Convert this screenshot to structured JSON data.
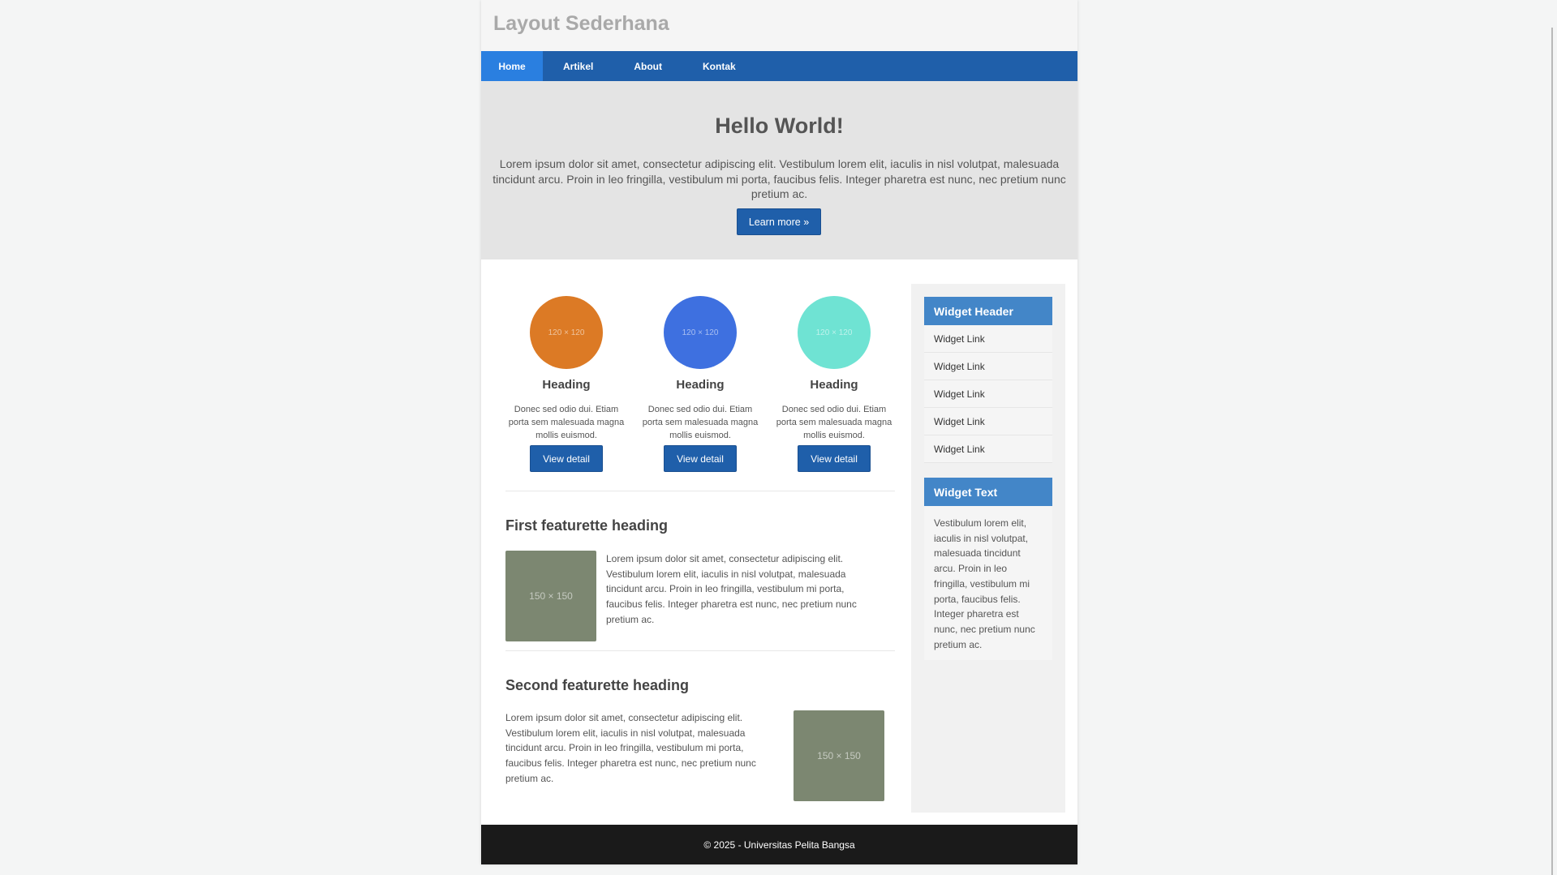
{
  "site": {
    "title": "Layout Sederhana"
  },
  "nav": {
    "items": [
      {
        "label": "Home"
      },
      {
        "label": "Artikel"
      },
      {
        "label": "About"
      },
      {
        "label": "Kontak"
      }
    ]
  },
  "hero": {
    "title": "Hello World!",
    "text": "Lorem ipsum dolor sit amet, consectetur adipiscing elit. Vestibulum lorem elit, iaculis in nisl volutpat, malesuada tincidunt arcu. Proin in leo fringilla, vestibulum mi porta, faucibus felis. Integer pharetra est nunc, nec pretium nunc pretium ac.",
    "button": "Learn more »"
  },
  "features": [
    {
      "placeholder": "120 × 120",
      "color": "#dc7a25",
      "heading": "Heading",
      "text": "Donec sed odio dui. Etiam porta sem malesuada magna mollis euismod.",
      "button": "View detail"
    },
    {
      "placeholder": "120 × 120",
      "color": "#3e70e0",
      "heading": "Heading",
      "text": "Donec sed odio dui. Etiam porta sem malesuada magna mollis euismod.",
      "button": "View detail"
    },
    {
      "placeholder": "120 × 120",
      "color": "#6fe3d3",
      "heading": "Heading",
      "text": "Donec sed odio dui. Etiam porta sem malesuada magna mollis euismod.",
      "button": "View detail"
    }
  ],
  "featurettes": [
    {
      "heading": "First featurette heading",
      "placeholder": "150 × 150",
      "text": "Lorem ipsum dolor sit amet, consectetur adipiscing elit. Vestibulum lorem elit, iaculis in nisl volutpat, malesuada tincidunt arcu. Proin in leo fringilla, vestibulum mi porta, faucibus felis. Integer pharetra est nunc, nec pretium nunc pretium ac."
    },
    {
      "heading": "Second featurette heading",
      "placeholder": "150 × 150",
      "text": "Lorem ipsum dolor sit amet, consectetur adipiscing elit. Vestibulum lorem elit, iaculis in nisl volutpat, malesuada tincidunt arcu. Proin in leo fringilla, vestibulum mi porta, faucibus felis. Integer pharetra est nunc, nec pretium nunc pretium ac."
    }
  ],
  "sidebar": {
    "widget1": {
      "header": "Widget Header",
      "links": [
        "Widget Link",
        "Widget Link",
        "Widget Link",
        "Widget Link",
        "Widget Link"
      ]
    },
    "widget2": {
      "header": "Widget Text",
      "text": "Vestibulum lorem elit, iaculis in nisl volutpat, malesuada tincidunt arcu. Proin in leo fringilla, vestibulum mi porta, faucibus felis. Integer pharetra est nunc, nec pretium nunc pretium ac."
    }
  },
  "footer": {
    "text": "© 2025 - Universitas Pelita Bangsa"
  },
  "colors": {
    "nav": "#1f5faa",
    "nav_active": "#2a7fe0",
    "widget_header": "#4386c8",
    "featurette_img": "#7c8771",
    "footer": "#1a1a1a"
  }
}
